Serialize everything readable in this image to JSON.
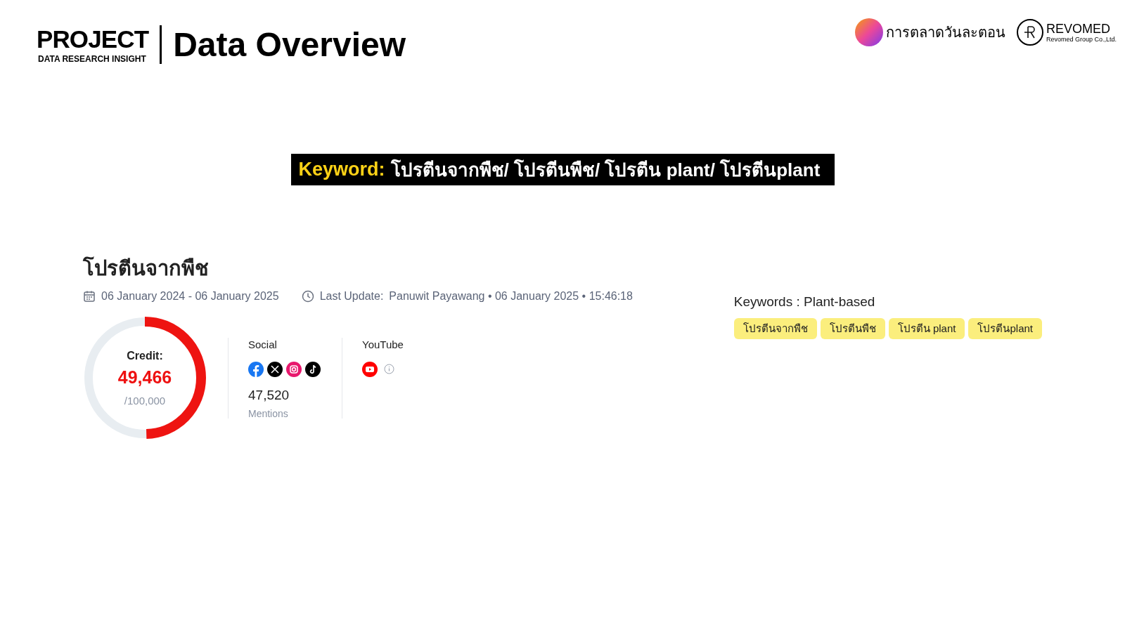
{
  "header": {
    "brand": "PROJECT",
    "brand_subtitle": "DATA RESEARCH INSIGHT",
    "title": "Data Overview"
  },
  "partner_logos": [
    {
      "kind": "round",
      "text": "การตลาดวันละตอน"
    },
    {
      "kind": "mark",
      "text": "REVOMED",
      "subtext": "Revomed Group Co.,Ltd."
    }
  ],
  "keyword_banner": {
    "label": "Keyword:",
    "value": "โปรตีนจากพืช/ โปรตีนพืช/ โปรตีน plant/ โปรตีนplant"
  },
  "project": {
    "title": "โปรตีนจากพืช",
    "date_range": "06 January 2024 - 06 January 2025",
    "last_update_label": "Last Update:",
    "last_update_value": "Panuwit Payawang • 06 January 2025 • 15:46:18"
  },
  "credit": {
    "label": "Credit:",
    "used": "49,466",
    "total": "/100,000",
    "level": 0.49466
  },
  "sources": [
    {
      "kind": "social",
      "title": "Social",
      "count": "47,520",
      "unit": "Mentions"
    },
    {
      "kind": "youtube",
      "title": "YouTube"
    }
  ],
  "keywords": {
    "title": "Keywords : Plant-based",
    "tags": [
      "โปรตีนจากพืช",
      "โปรตีนพืช",
      "โปรตีน plant",
      "โปรตีนplant"
    ]
  }
}
